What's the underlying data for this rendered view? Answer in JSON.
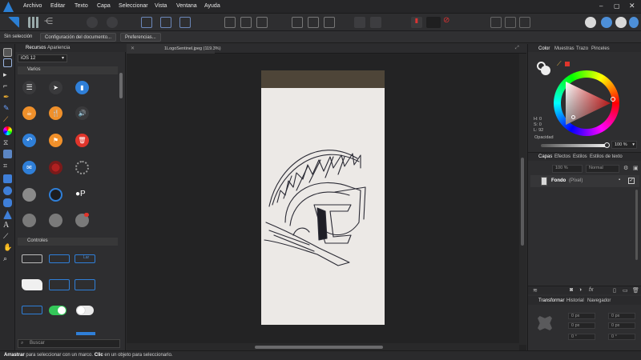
{
  "menu": [
    "Archivo",
    "Editar",
    "Texto",
    "Capa",
    "Seleccionar",
    "Vista",
    "Ventana",
    "Ayuda"
  ],
  "context_bar": {
    "selection": "Sin selección",
    "doc_setup": "Configuración del documento...",
    "prefs": "Preferencias..."
  },
  "left_panel": {
    "tabs": [
      "Recursos",
      "Apariencia"
    ],
    "preset": "iOS 12",
    "section1": "Varios",
    "section2": "Controles",
    "search_placeholder": "Buscar",
    "label_p": "P"
  },
  "document": {
    "tab_label": "1LogoSentinel.jpeg (119.3%)"
  },
  "right_panel": {
    "color_tabs": [
      "Color",
      "Muestras",
      "Trazo",
      "Pinceles"
    ],
    "hsl": {
      "h": "H: 0",
      "s": "S: 0",
      "l": "L: 92"
    },
    "opacity_label": "Opacidad",
    "opacity_value": "100 %",
    "layer_tabs": [
      "Capas",
      "Efectos",
      "Estilos",
      "Estilos de texto"
    ],
    "layer_opacity": "100 %",
    "blend_mode": "Normal",
    "layer_name": "Fondo",
    "layer_type": "(Píxel)",
    "transform_tabs": [
      "Transformar",
      "Historial",
      "Navegador"
    ],
    "transform_fields": [
      "0 px",
      "0 px",
      "0 px",
      "0 px",
      "0 °",
      "0 °"
    ]
  },
  "status": {
    "b1": "Arrastrar",
    "t1": " para seleccionar con un marco. ",
    "b2": "Clic",
    "t2": " en un objeto para seleccionarlo."
  },
  "colors": {
    "accent_blue": "#2f7fd8",
    "orange": "#f0902a",
    "red": "#e0352b",
    "app_bg": "#2b2b2d"
  }
}
